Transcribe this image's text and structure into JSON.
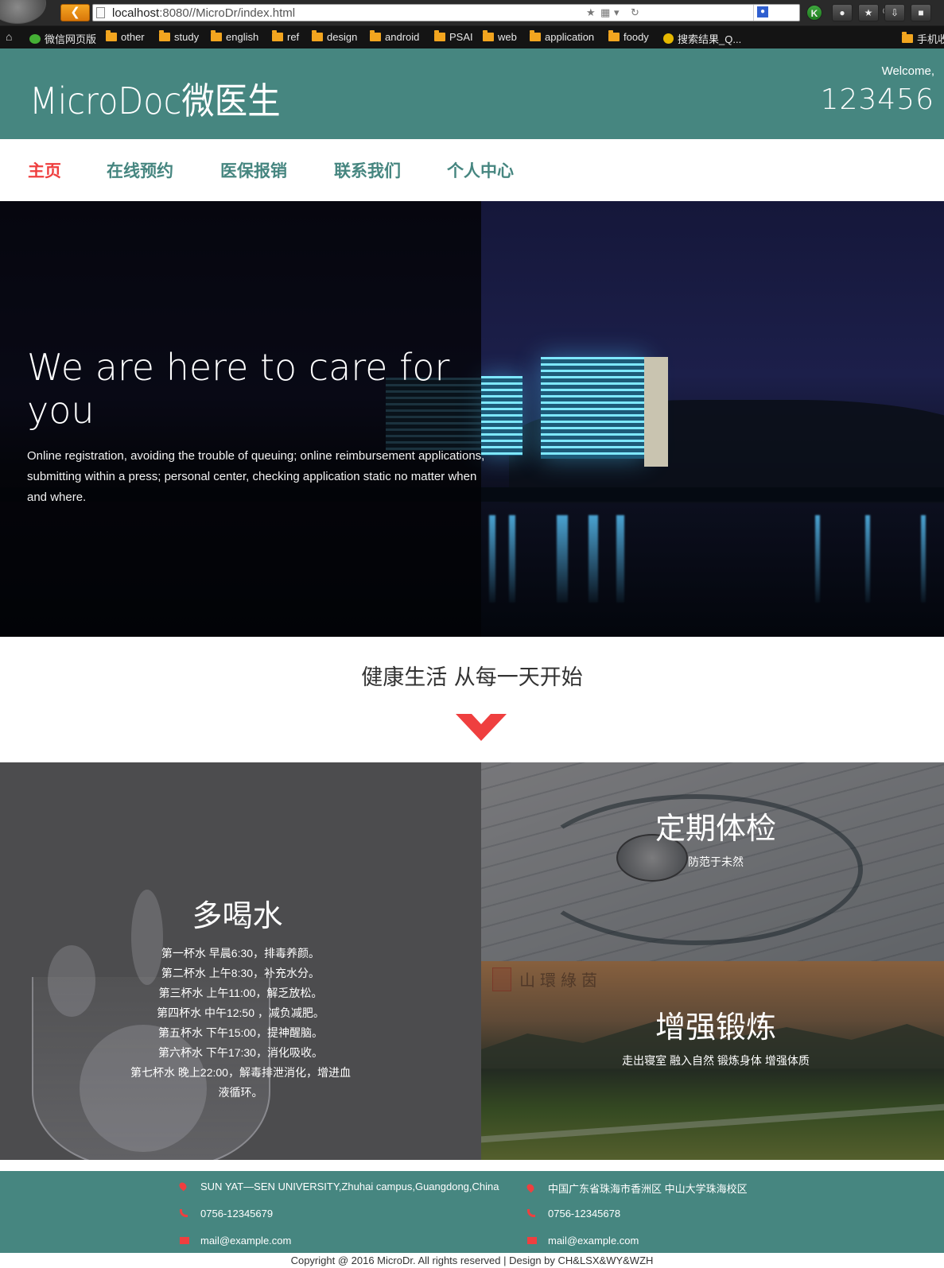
{
  "browser": {
    "url_host": "localhost",
    "url_rest": ":8080//MicroDr/index.html",
    "bookmarks": [
      {
        "label": "微信网页版",
        "icon": "wechat-icon"
      },
      {
        "label": "other",
        "icon": "folder-icon"
      },
      {
        "label": "study",
        "icon": "folder-icon"
      },
      {
        "label": "english",
        "icon": "folder-icon"
      },
      {
        "label": "ref",
        "icon": "folder-icon"
      },
      {
        "label": "design",
        "icon": "folder-icon"
      },
      {
        "label": "android",
        "icon": "folder-icon"
      },
      {
        "label": "PSAI",
        "icon": "folder-icon"
      },
      {
        "label": "web",
        "icon": "folder-icon"
      },
      {
        "label": "application",
        "icon": "folder-icon"
      },
      {
        "label": "foody",
        "icon": "folder-icon"
      },
      {
        "label": "搜索结果_Q...",
        "icon": "search-result-icon"
      },
      {
        "label": "手机收",
        "icon": "folder-icon"
      }
    ]
  },
  "header": {
    "brand": "MicroDoc微医生",
    "welcome": "Welcome,",
    "user_id": "123456"
  },
  "nav": {
    "items": [
      "主页",
      "在线预约",
      "医保报销",
      "联系我们",
      "个人中心"
    ],
    "active": "主页"
  },
  "hero": {
    "title": "We are here to care for you",
    "description": "Online registration, avoiding the trouble of queuing; online reimbursement applications, submitting within a press; personal center, checking application static no matter when and where."
  },
  "slogan": "健康生活 从每一天开始",
  "features": {
    "water": {
      "title": "多喝水",
      "items": [
        "第一杯水 早晨6:30，排毒养颜。",
        "第二杯水 上午8:30，补充水分。",
        "第三杯水 上午11:00，解乏放松。",
        "第四杯水 中午12:50 ，减负减肥。",
        "第五杯水 下午15:00，提神醒脑。",
        "第六杯水 下午17:30，消化吸收。",
        "第七杯水 晚上22:00，解毒排泄消化，增进血液循环。"
      ]
    },
    "checkup": {
      "title": "定期体检",
      "subtitle": "防范于未然"
    },
    "exercise": {
      "title": "增强锻炼",
      "subtitle": "走出寝室 融入自然 锻炼身体 增强体质",
      "watermark": "山環綠茵"
    }
  },
  "footer": {
    "address_en": "SUN YAT—SEN UNIVERSITY,Zhuhai campus,Guangdong,China",
    "address_cn": "中国广东省珠海市香洲区 中山大学珠海校区",
    "phone_1": "0756-12345679",
    "phone_2": "0756-12345678",
    "email_1": "mail@example.com",
    "email_2": "mail@example.com",
    "copyright": "Copyright @ 2016 MicroDr. All rights reserved | Design by CH&LSX&WY&WZH"
  },
  "colors": {
    "brand_teal": "#468680",
    "accent_red": "#ef3f3f"
  }
}
